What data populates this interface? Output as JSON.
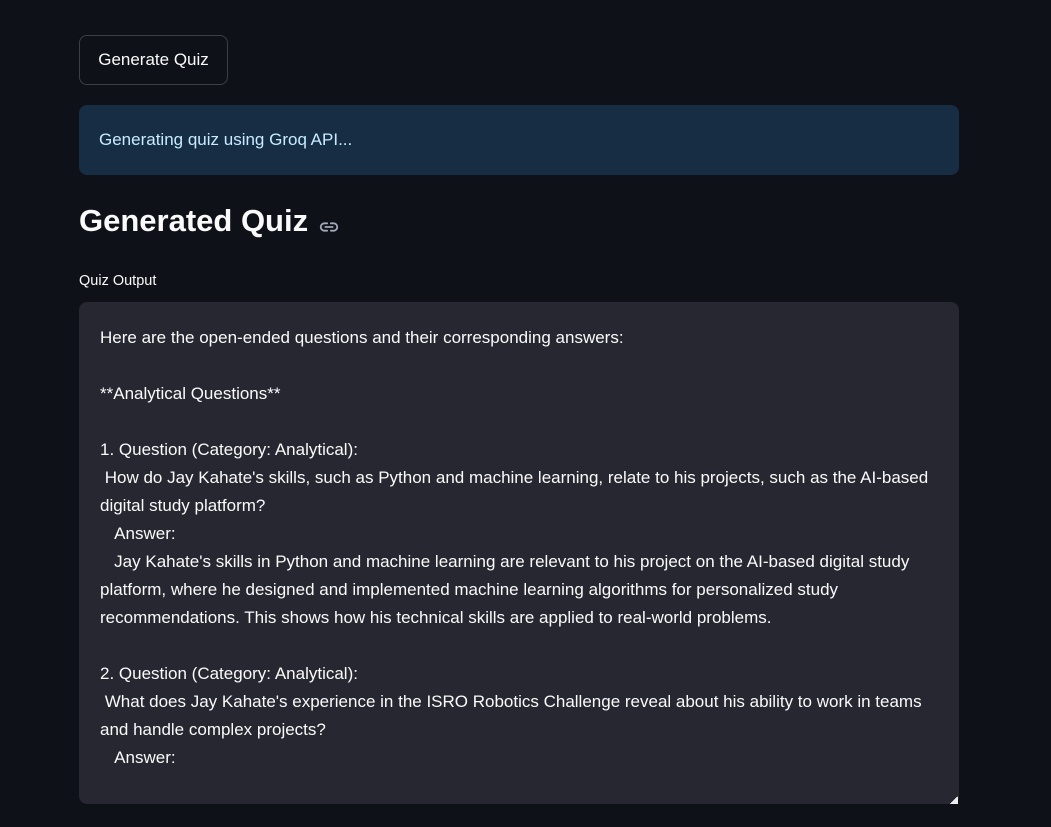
{
  "button": {
    "label": "Generate Quiz"
  },
  "info": {
    "message": "Generating quiz using Groq API..."
  },
  "heading": {
    "title": "Generated Quiz",
    "icon": "link-icon"
  },
  "textarea": {
    "label": "Quiz Output",
    "value": "Here are the open-ended questions and their corresponding answers:\n\n**Analytical Questions**\n\n1. Question (Category: Analytical):\n How do Jay Kahate's skills, such as Python and machine learning, relate to his projects, such as the AI-based digital study platform?\n   Answer:\n   Jay Kahate's skills in Python and machine learning are relevant to his project on the AI-based digital study platform, where he designed and implemented machine learning algorithms for personalized study recommendations. This shows how his technical skills are applied to real-world problems.\n\n2. Question (Category: Analytical):\n What does Jay Kahate's experience in the ISRO Robotics Challenge reveal about his ability to work in teams and handle complex projects?\n   Answer:"
  }
}
